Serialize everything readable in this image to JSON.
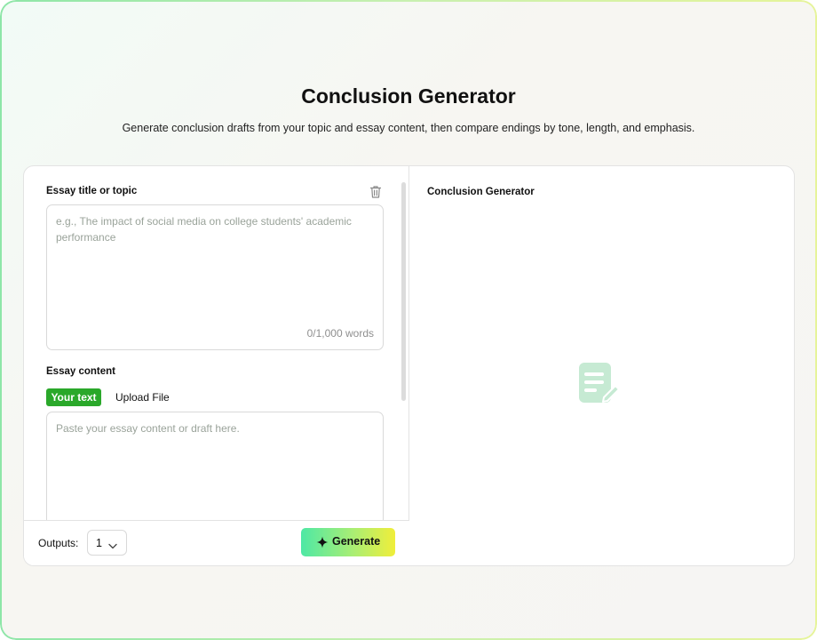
{
  "header": {
    "title": "Conclusion Generator",
    "subtitle": "Generate conclusion drafts from your topic and essay content, then compare endings by tone, length, and emphasis."
  },
  "form": {
    "title_label": "Essay title or topic",
    "title_placeholder": "e.g., The impact of social media on college students' academic performance",
    "word_count": "0/1,000 words",
    "content_label": "Essay content",
    "tabs": {
      "your_text": "Your text",
      "upload_file": "Upload File"
    },
    "content_placeholder": "Paste your essay content or draft here."
  },
  "footer": {
    "outputs_label": "Outputs:",
    "outputs_value": "1",
    "generate_label": "Generate"
  },
  "result": {
    "title": "Conclusion Generator"
  },
  "icons": {
    "delete": "trash-icon",
    "dropdown": "chevron-down-icon",
    "generate": "sparkle-icon",
    "empty": "document-edit-icon"
  },
  "colors": {
    "accent_green": "#2aa82a",
    "empty_icon": "#bfe6cd",
    "generate_gradient_start": "#4ee8a5",
    "generate_gradient_end": "#f0ee3a"
  }
}
